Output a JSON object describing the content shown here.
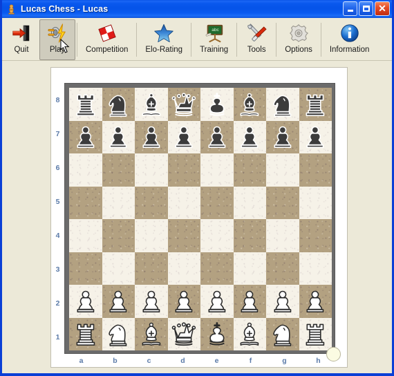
{
  "window": {
    "title": "Lucas Chess - Lucas",
    "title_icon": "chess-pawn-icon",
    "controls": {
      "minimize_label": "_",
      "maximize_label": "",
      "close_label": "✕"
    }
  },
  "toolbar": {
    "items": [
      {
        "id": "quit",
        "label": "Quit",
        "icon": "exit-door-arrow-icon",
        "state": "normal"
      },
      {
        "id": "play",
        "label": "Play",
        "icon": "plug-lightning-icon",
        "state": "hover"
      },
      {
        "id": "competition",
        "label": "Competition",
        "icon": "red-checker-diamond-icon",
        "state": "normal"
      },
      {
        "id": "elo-rating",
        "label": "Elo-Rating",
        "icon": "blue-star-icon",
        "state": "normal"
      },
      {
        "id": "training",
        "label": "Training",
        "icon": "green-chalkboard-icon",
        "state": "normal"
      },
      {
        "id": "tools",
        "label": "Tools",
        "icon": "wrench-screwdriver-icon",
        "state": "normal"
      },
      {
        "id": "options",
        "label": "Options",
        "icon": "gear-icon",
        "state": "normal"
      },
      {
        "id": "information",
        "label": "Information",
        "icon": "blue-info-circle-icon",
        "state": "normal"
      }
    ]
  },
  "board": {
    "file_labels": [
      "a",
      "b",
      "c",
      "d",
      "e",
      "f",
      "g",
      "h"
    ],
    "rank_labels": [
      "8",
      "7",
      "6",
      "5",
      "4",
      "3",
      "2",
      "1"
    ],
    "orientation": "white-bottom",
    "turn_indicator": "white",
    "colors": {
      "light_square": "#f6f2e8",
      "dark_square": "#b3a181",
      "frame": "#6b6b6b",
      "label": "#5a7aa8",
      "white_piece_fill": "#ffffff",
      "white_piece_stroke": "#2b2b2b",
      "black_piece_fill": "#3c3c3c",
      "black_piece_stroke": "#ffffff"
    },
    "fen": "rnbqkbnr/pppppppp/8/8/8/8/PPPPPPPP/RNBQKBNR w KQkq - 0 1",
    "rows": [
      [
        "r",
        "n",
        "b",
        "q",
        "k",
        "b",
        "n",
        "r"
      ],
      [
        "p",
        "p",
        "p",
        "p",
        "p",
        "p",
        "p",
        "p"
      ],
      [
        "",
        "",
        "",
        "",
        "",
        "",
        "",
        ""
      ],
      [
        "",
        "",
        "",
        "",
        "",
        "",
        "",
        ""
      ],
      [
        "",
        "",
        "",
        "",
        "",
        "",
        "",
        ""
      ],
      [
        "",
        "",
        "",
        "",
        "",
        "",
        "",
        ""
      ],
      [
        "P",
        "P",
        "P",
        "P",
        "P",
        "P",
        "P",
        "P"
      ],
      [
        "R",
        "N",
        "B",
        "Q",
        "K",
        "B",
        "N",
        "R"
      ]
    ]
  }
}
